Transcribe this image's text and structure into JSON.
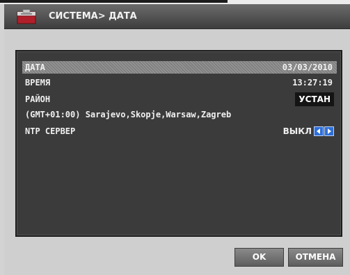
{
  "header": {
    "title": "СИСТЕМА> ДАТА",
    "icon": "folder-red-icon"
  },
  "settings": {
    "date": {
      "label": "ДАТА",
      "value": "03/03/2010"
    },
    "time": {
      "label": "ВРЕМЯ",
      "value": "13:27:19"
    },
    "zone": {
      "label": "РАЙОН",
      "button": "УСТАН",
      "value": "(GMT+01:00) Sarajevo,Skopje,Warsaw,Zagreb"
    },
    "ntp": {
      "label": "NTP СЕРВЕР",
      "value": "ВЫКЛ"
    }
  },
  "buttons": {
    "ok": "OK",
    "cancel": "ОТМЕНА"
  },
  "colors": {
    "accent": "#2e6fd8",
    "header": "#4a4a4a",
    "screen": "#3b3b3b"
  }
}
